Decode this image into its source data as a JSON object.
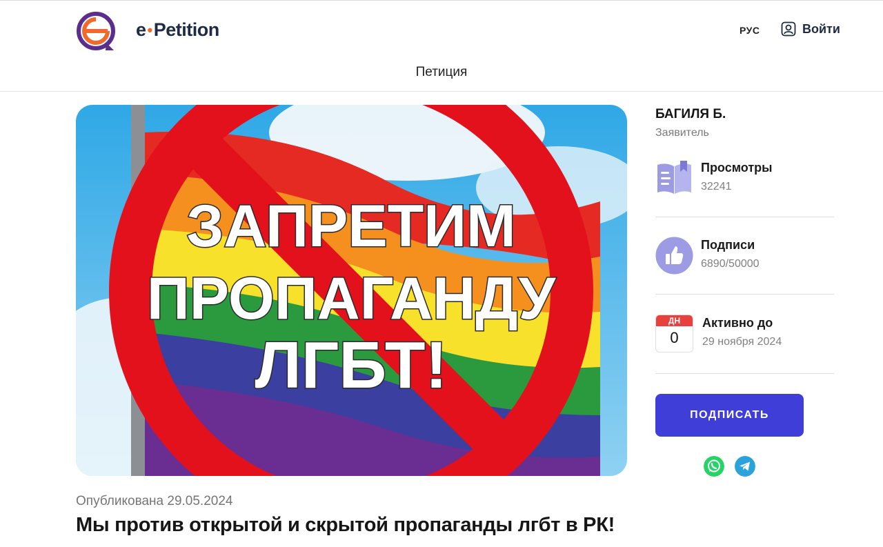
{
  "header": {
    "brand_prefix": "e",
    "brand_name": "Petition",
    "language": "РУС",
    "login_label": "Войти",
    "nav_title": "Петиция"
  },
  "hero": {
    "banner_lines": [
      "ЗАПРЕТИМ",
      "ПРОПАГАНДУ",
      "ЛГБТ!"
    ]
  },
  "petition": {
    "published": "Опубликована 29.05.2024",
    "title": "Мы против открытой и скрытой пропаганды лгбт в РК!"
  },
  "sidebar": {
    "author_name": "БАГИЛЯ Б.",
    "author_role": "Заявитель",
    "views": {
      "label": "Просмотры",
      "value": "32241",
      "icon": "book-icon"
    },
    "signatures": {
      "label": "Подписи",
      "value": "6890/50000",
      "current": 6890,
      "goal": 50000,
      "icon": "thumbs-up-icon"
    },
    "active_until": {
      "label": "Активно до",
      "value": "29 ноября 2024",
      "calendar_top": "ДН",
      "calendar_number": "0",
      "icon": "calendar-icon"
    },
    "sign_button": "ПОДПИСАТЬ",
    "share": [
      "whatsapp-icon",
      "telegram-icon"
    ]
  },
  "colors": {
    "primary": "#3f3ed8",
    "brand_orange": "#f26a2b",
    "brand_purple": "#5b2d8c",
    "stat_icon": "#9d9be3",
    "calendar_red": "#e8403c",
    "whatsapp": "#25d366",
    "telegram": "#2aa3dc"
  }
}
